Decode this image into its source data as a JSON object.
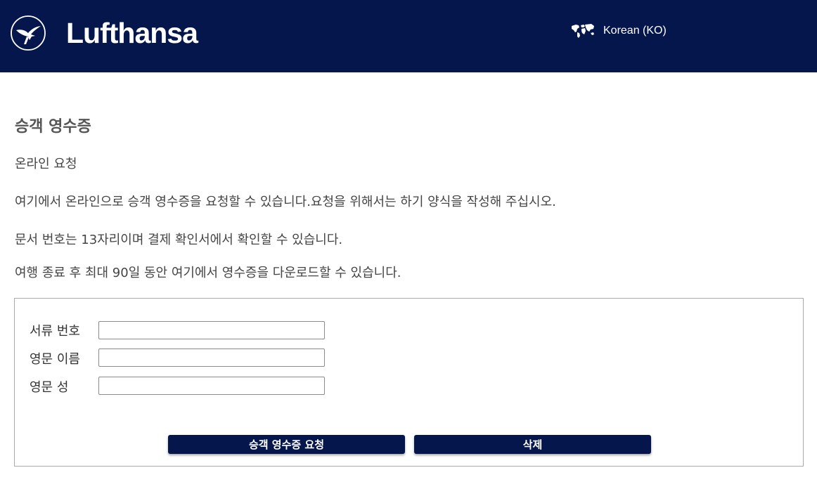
{
  "header": {
    "brand": "Lufthansa",
    "language": "Korean (KO)",
    "icons": {
      "logo": "crane-logo-icon",
      "language": "globe-map-icon"
    },
    "colors": {
      "header_bg": "#05164d",
      "button_bg": "#05164d"
    }
  },
  "main": {
    "title": "승객 영수증",
    "paragraphs": [
      "온라인 요청",
      "여기에서 온라인으로 승객 영수증을 요청할 수 있습니다.요청을 위해서는 하기 양식을 작성해 주십시오.",
      "문서 번호는 13자리이며 결제 확인서에서 확인할 수 있습니다.",
      "여행 종료 후 최대 90일 동안 여기에서 영수증을 다운로드할 수 있습니다."
    ]
  },
  "form": {
    "fields": [
      {
        "label": "서류 번호",
        "value": "",
        "placeholder": ""
      },
      {
        "label": "영문 이름",
        "value": "",
        "placeholder": ""
      },
      {
        "label": "영문 성",
        "value": "",
        "placeholder": ""
      }
    ],
    "submit_label": "승객 영수증 요청",
    "delete_label": "삭제"
  }
}
